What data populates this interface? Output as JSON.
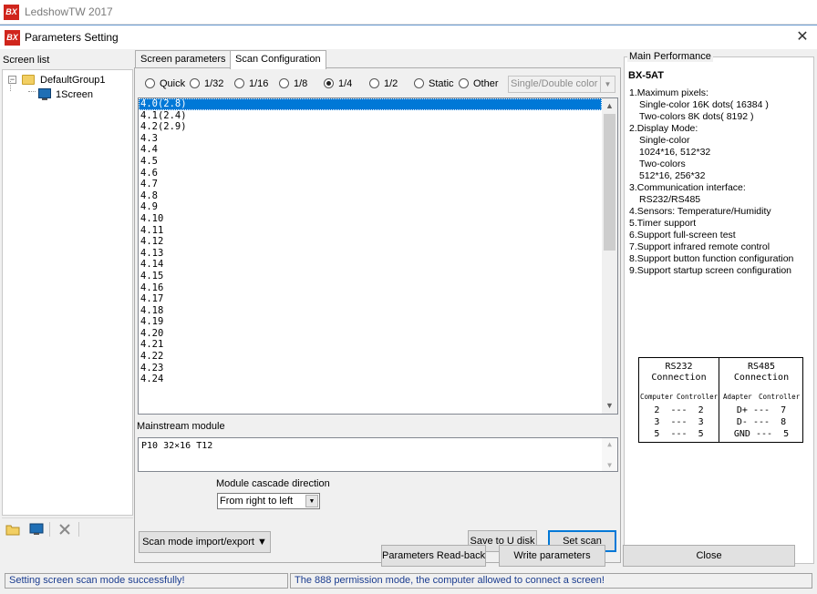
{
  "app": {
    "logo": "BX",
    "title": "LedshowTW 2017"
  },
  "dialog": {
    "logo": "BX",
    "title": "Parameters Setting",
    "close_glyph": "✕"
  },
  "screen_list": {
    "label": "Screen list",
    "group": {
      "expander": "−",
      "name": "DefaultGroup1"
    },
    "screen": {
      "name": "1Screen"
    }
  },
  "tabs": [
    {
      "label": "Screen parameters",
      "active": false
    },
    {
      "label": "Scan Configuration",
      "active": true
    }
  ],
  "scan_modes": [
    {
      "label": "Quick",
      "selected": false
    },
    {
      "label": "1/32",
      "selected": false
    },
    {
      "label": "1/16",
      "selected": false
    },
    {
      "label": "1/8",
      "selected": false
    },
    {
      "label": "1/4",
      "selected": true
    },
    {
      "label": "1/2",
      "selected": false
    },
    {
      "label": "Static",
      "selected": false
    },
    {
      "label": "Other",
      "selected": false
    }
  ],
  "color_mode": {
    "value": "Single/Double color",
    "arrow": "▼"
  },
  "scan_list": {
    "selected_index": 0,
    "items": [
      "4.0(2.8)",
      "4.1(2.4)",
      "4.2(2.9)",
      "4.3",
      "4.4",
      "4.5",
      "4.6",
      "4.7",
      "4.8",
      "4.9",
      "4.10",
      "4.11",
      "4.12",
      "4.13",
      "4.14",
      "4.15",
      "4.16",
      "4.17",
      "4.18",
      "4.19",
      "4.20",
      "4.21",
      "4.22",
      "4.23",
      "4.24"
    ],
    "scroll_up": "▲",
    "scroll_down": "▼"
  },
  "mainstream": {
    "label": "Mainstream module",
    "value": "P10  32×16  T12",
    "up": "▲",
    "down": "▼"
  },
  "cascade": {
    "label": "Module cascade direction",
    "value": "From right to left",
    "arrow": "▼"
  },
  "buttons": {
    "import_export": "Scan mode import/export ▼",
    "save_u_disk": "Save to U disk",
    "set_scan": "Set scan",
    "read_back": "Parameters Read-back",
    "write_params": "Write parameters",
    "close": "Close"
  },
  "performance": {
    "legend": "Main Performance",
    "model": "BX-5AT",
    "lines": [
      {
        "text": "1.Maximum pixels:",
        "indent": false
      },
      {
        "text": "Single-color 16K dots( 16384 )",
        "indent": true
      },
      {
        "text": "Two-colors 8K dots( 8192 )",
        "indent": true
      },
      {
        "text": "2.Display Mode:",
        "indent": false
      },
      {
        "text": "Single-color",
        "indent": true
      },
      {
        "text": "1024*16, 512*32",
        "indent": true
      },
      {
        "text": "Two-colors",
        "indent": true
      },
      {
        "text": "512*16, 256*32",
        "indent": true
      },
      {
        "text": "3.Communication interface:",
        "indent": false
      },
      {
        "text": "RS232/RS485",
        "indent": true
      },
      {
        "text": "4.Sensors: Temperature/Humidity",
        "indent": false
      },
      {
        "text": "5.Timer support",
        "indent": false
      },
      {
        "text": "6.Support full-screen test",
        "indent": false
      },
      {
        "text": "7.Support infrared remote control",
        "indent": false
      },
      {
        "text": "8.Support button function configuration",
        "indent": false
      },
      {
        "text": "9.Support startup screen configuration",
        "indent": false
      }
    ],
    "connections": {
      "rs232": {
        "title1": "RS232",
        "title2": "Connection",
        "sub_left": "Computer",
        "sub_right": "Controller",
        "rows": [
          "2  ---  2",
          "3  ---  3",
          "5  ---  5"
        ]
      },
      "rs485": {
        "title1": "RS485",
        "title2": "Connection",
        "sub_left": "Adapter",
        "sub_right": "Controller",
        "rows": [
          "D+ ---  7",
          "D- ---  8",
          "GND ---  5"
        ]
      }
    }
  },
  "status": {
    "left": "Setting screen scan mode successfully!",
    "right": "The 888 permission mode, the computer allowed to connect a screen!"
  }
}
